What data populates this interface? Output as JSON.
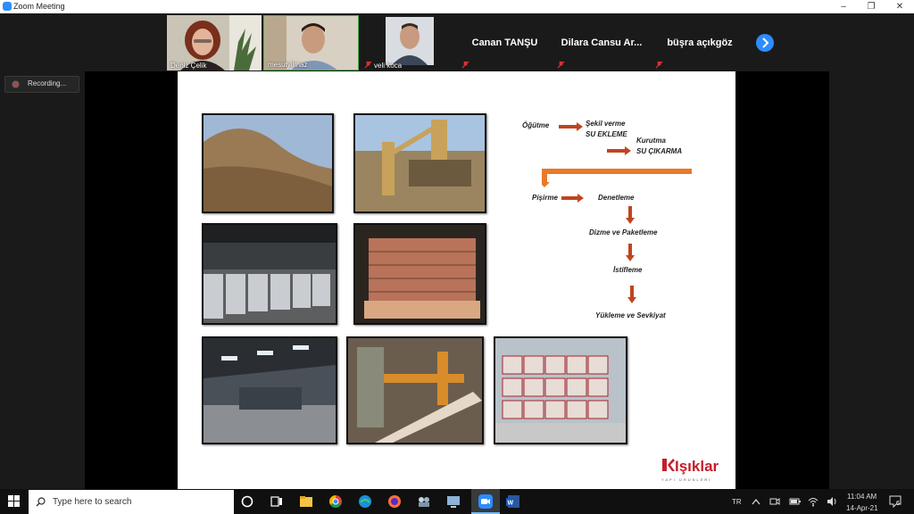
{
  "window": {
    "title": "Zoom Meeting"
  },
  "participants": {
    "p1": "Deniz Çelik",
    "p2": "mesutyilmaz",
    "p3": "veli koca",
    "p4": "Canan TANŞU",
    "p5": "Dilara Cansu Ar...",
    "p6": "büşra açıkgöz"
  },
  "recording": {
    "label": "Recording..."
  },
  "slide": {
    "flow": {
      "step1": "Öğütme",
      "step2a": "Şekil verme",
      "step2b": "SU EKLEME",
      "step3a": "Kurutma",
      "step3b": "SU ÇIKARMA",
      "step4": "Pişirme",
      "step5": "Denetleme",
      "step6": "Dizme ve Paketleme",
      "step7": "İstifleme",
      "step8": "Yükleme ve Sevkiyat"
    },
    "logo": {
      "name": "Işıklar",
      "sub": "YAPI ÜRÜNLERİ"
    }
  },
  "taskbar": {
    "search_placeholder": "Type here to search",
    "lang": "TR",
    "time": "11:04 AM",
    "date": "14-Apr-21",
    "notifications": "6"
  },
  "colors": {
    "accent": "#2d8cff",
    "arrow": "#c0451f",
    "logo_red": "#c41e2a"
  }
}
